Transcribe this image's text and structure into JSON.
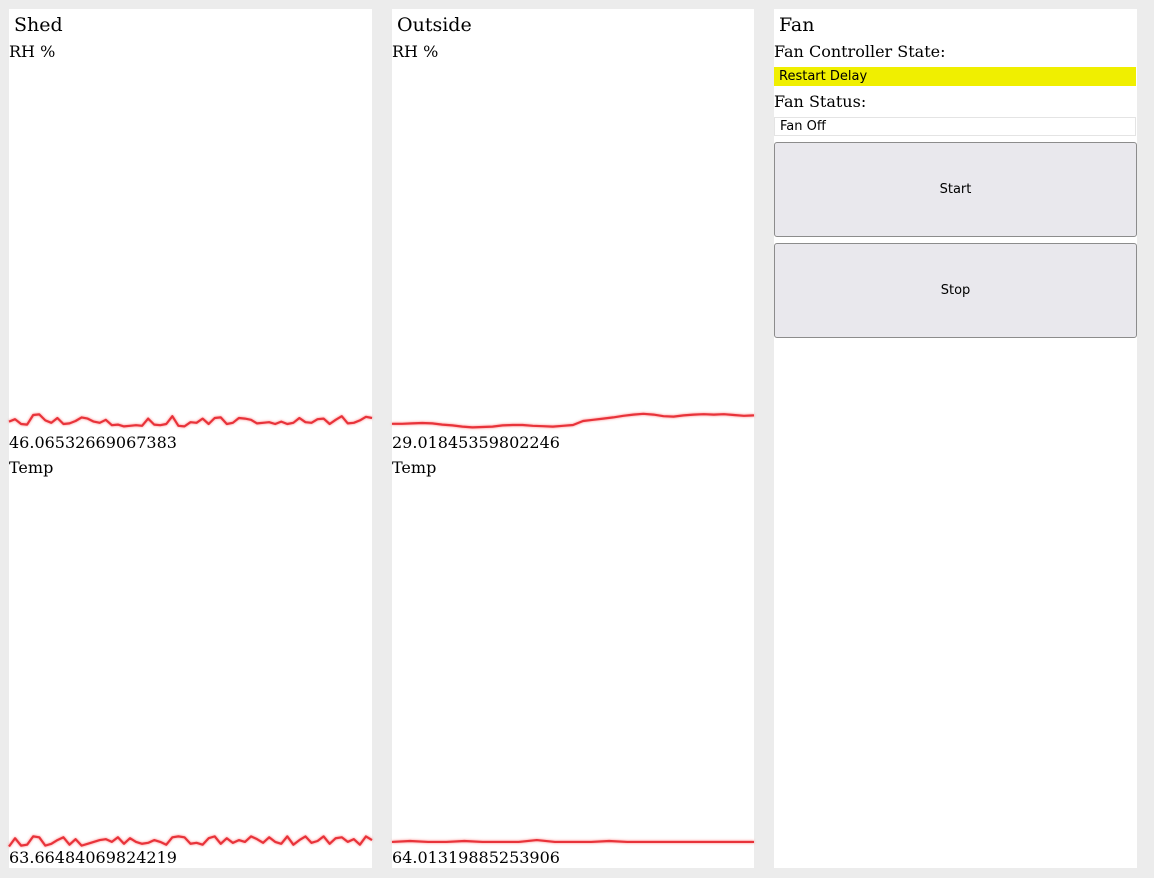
{
  "colors": {
    "sparkline": "#e8333a",
    "restart_delay_bg": "#f0ef00",
    "panel_bg": "#ffffff",
    "page_bg": "#ececec"
  },
  "shed": {
    "title": "Shed",
    "rh": {
      "label": "RH %",
      "value": "46.06532669067383",
      "series": [
        46.4,
        46.8,
        46.0,
        45.9,
        47.5,
        47.6,
        46.6,
        46.2,
        47.0,
        46.0,
        46.1,
        46.5,
        47.1,
        46.9,
        46.4,
        46.2,
        46.7,
        45.8,
        45.9,
        45.6,
        45.7,
        45.8,
        45.7,
        46.9,
        45.9,
        45.8,
        46.0,
        47.3,
        45.7,
        45.6,
        46.3,
        46.2,
        46.9,
        46.0,
        47.0,
        47.1,
        46.0,
        46.2,
        47.0,
        46.9,
        46.7,
        46.1,
        46.2,
        46.3,
        46.0,
        46.4,
        46.0,
        46.2,
        47.0,
        46.3,
        46.2,
        46.8,
        46.9,
        46.0,
        46.7,
        47.3,
        46.1,
        46.2,
        46.6,
        47.2,
        47.0
      ]
    },
    "temp": {
      "label": "Temp",
      "value": "63.66484069824219",
      "series": [
        63.5,
        64.4,
        63.6,
        63.7,
        64.6,
        64.5,
        63.6,
        63.8,
        64.2,
        64.5,
        63.7,
        64.3,
        63.6,
        63.8,
        64.0,
        64.2,
        64.3,
        64.0,
        64.5,
        63.8,
        64.4,
        64.0,
        63.8,
        63.9,
        64.2,
        64.0,
        63.7,
        64.5,
        64.6,
        64.5,
        63.8,
        63.9,
        63.7,
        64.4,
        64.6,
        63.8,
        64.4,
        63.9,
        64.2,
        64.0,
        64.6,
        64.3,
        63.9,
        64.5,
        64.0,
        63.8,
        64.6,
        63.7,
        64.2,
        64.6,
        63.9,
        64.1,
        64.6,
        63.8,
        64.4,
        64.5,
        64.0,
        64.3,
        63.7,
        64.6,
        64.2
      ]
    }
  },
  "outside": {
    "title": "Outside",
    "rh": {
      "label": "RH %",
      "value": "29.01845359802246",
      "series": [
        29.8,
        29.8,
        29.9,
        30.0,
        29.9,
        29.6,
        29.4,
        29.1,
        28.9,
        29.0,
        29.1,
        29.4,
        29.5,
        29.5,
        29.3,
        29.2,
        29.1,
        29.3,
        29.5,
        30.5,
        30.8,
        31.1,
        31.4,
        31.8,
        32.1,
        32.3,
        32.1,
        31.7,
        31.6,
        31.9,
        32.1,
        32.2,
        32.1,
        32.2,
        32.0,
        31.8,
        31.9
      ]
    },
    "temp": {
      "label": "Temp",
      "value": "64.01319885253906",
      "series": [
        64.0,
        64.1,
        64.0,
        64.0,
        64.1,
        64.0,
        64.0,
        64.0,
        64.2,
        64.0,
        64.0,
        64.0,
        64.1,
        64.0,
        64.0,
        64.0,
        64.0,
        64.0,
        64.0,
        64.0,
        64.0
      ]
    }
  },
  "fan": {
    "title": "Fan",
    "controller_state_label": "Fan Controller State:",
    "controller_state": "Restart Delay",
    "status_label": "Fan Status:",
    "status": "Fan Off",
    "start_label": "Start",
    "stop_label": "Stop"
  }
}
